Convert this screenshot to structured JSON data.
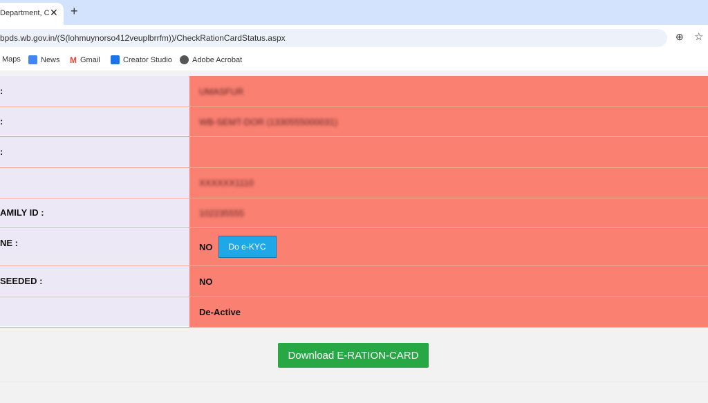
{
  "browser": {
    "tab_title": "Department, C",
    "url": "bpds.wb.gov.in/(S(lohmuynorso412veuplbrrfm))/CheckRationCardStatus.aspx",
    "bookmarks": [
      {
        "label": "Maps"
      },
      {
        "label": "News"
      },
      {
        "label": "Gmail"
      },
      {
        "label": "Creator Studio"
      },
      {
        "label": "Adobe Acrobat"
      }
    ]
  },
  "rows": [
    {
      "label": ":",
      "value": "UMASFUR"
    },
    {
      "label": ":",
      "value": "WB-SEMT-DOR (1330555000031)"
    },
    {
      "label": ":",
      "value": ""
    },
    {
      "label": "",
      "value": "XXXXXX1110"
    },
    {
      "label": "AMILY ID :",
      "value": "102235555"
    },
    {
      "label": "NE :",
      "value": "NO",
      "button": "Do e-KYC"
    },
    {
      "label": " SEEDED :",
      "value": "NO"
    },
    {
      "label": "",
      "value": "De-Active"
    }
  ],
  "download_label": "Download E-RATION-CARD",
  "colors": {
    "status_bg": "#fa8072",
    "label_bg": "#ece8f6",
    "download": "#28a745",
    "ekyc": "#1fa8e8"
  }
}
